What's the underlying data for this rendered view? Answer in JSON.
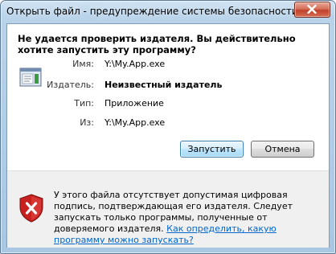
{
  "window": {
    "title": "Открыть файл - предупреждение системы безопасности"
  },
  "dialog": {
    "heading": "Не удается проверить издателя.  Вы действительно хотите запустить эту программу?",
    "fields": {
      "name_label": "Имя:",
      "name_value": "Y:\\My.App.exe",
      "publisher_label": "Издатель:",
      "publisher_value": "Неизвестный издатель",
      "type_label": "Тип:",
      "type_value": "Приложение",
      "from_label": "Из:",
      "from_value": "Y:\\My.App.exe"
    },
    "buttons": {
      "run": "Запустить",
      "cancel": "Отмена"
    },
    "warning": {
      "text": "У этого файла отсутствует допустимая цифровая подпись, подтверждающая его издателя.  Следует запускать только программы, полученные от доверяемого издателя.",
      "link": "Как определить, какую программу можно запускать?"
    }
  },
  "icons": {
    "app": "application-icon",
    "shield": "security-shield-error-icon",
    "close": "close-icon"
  },
  "colors": {
    "link": "#0066cc",
    "close_button": "#c0412a",
    "shield_red": "#c8201f"
  }
}
